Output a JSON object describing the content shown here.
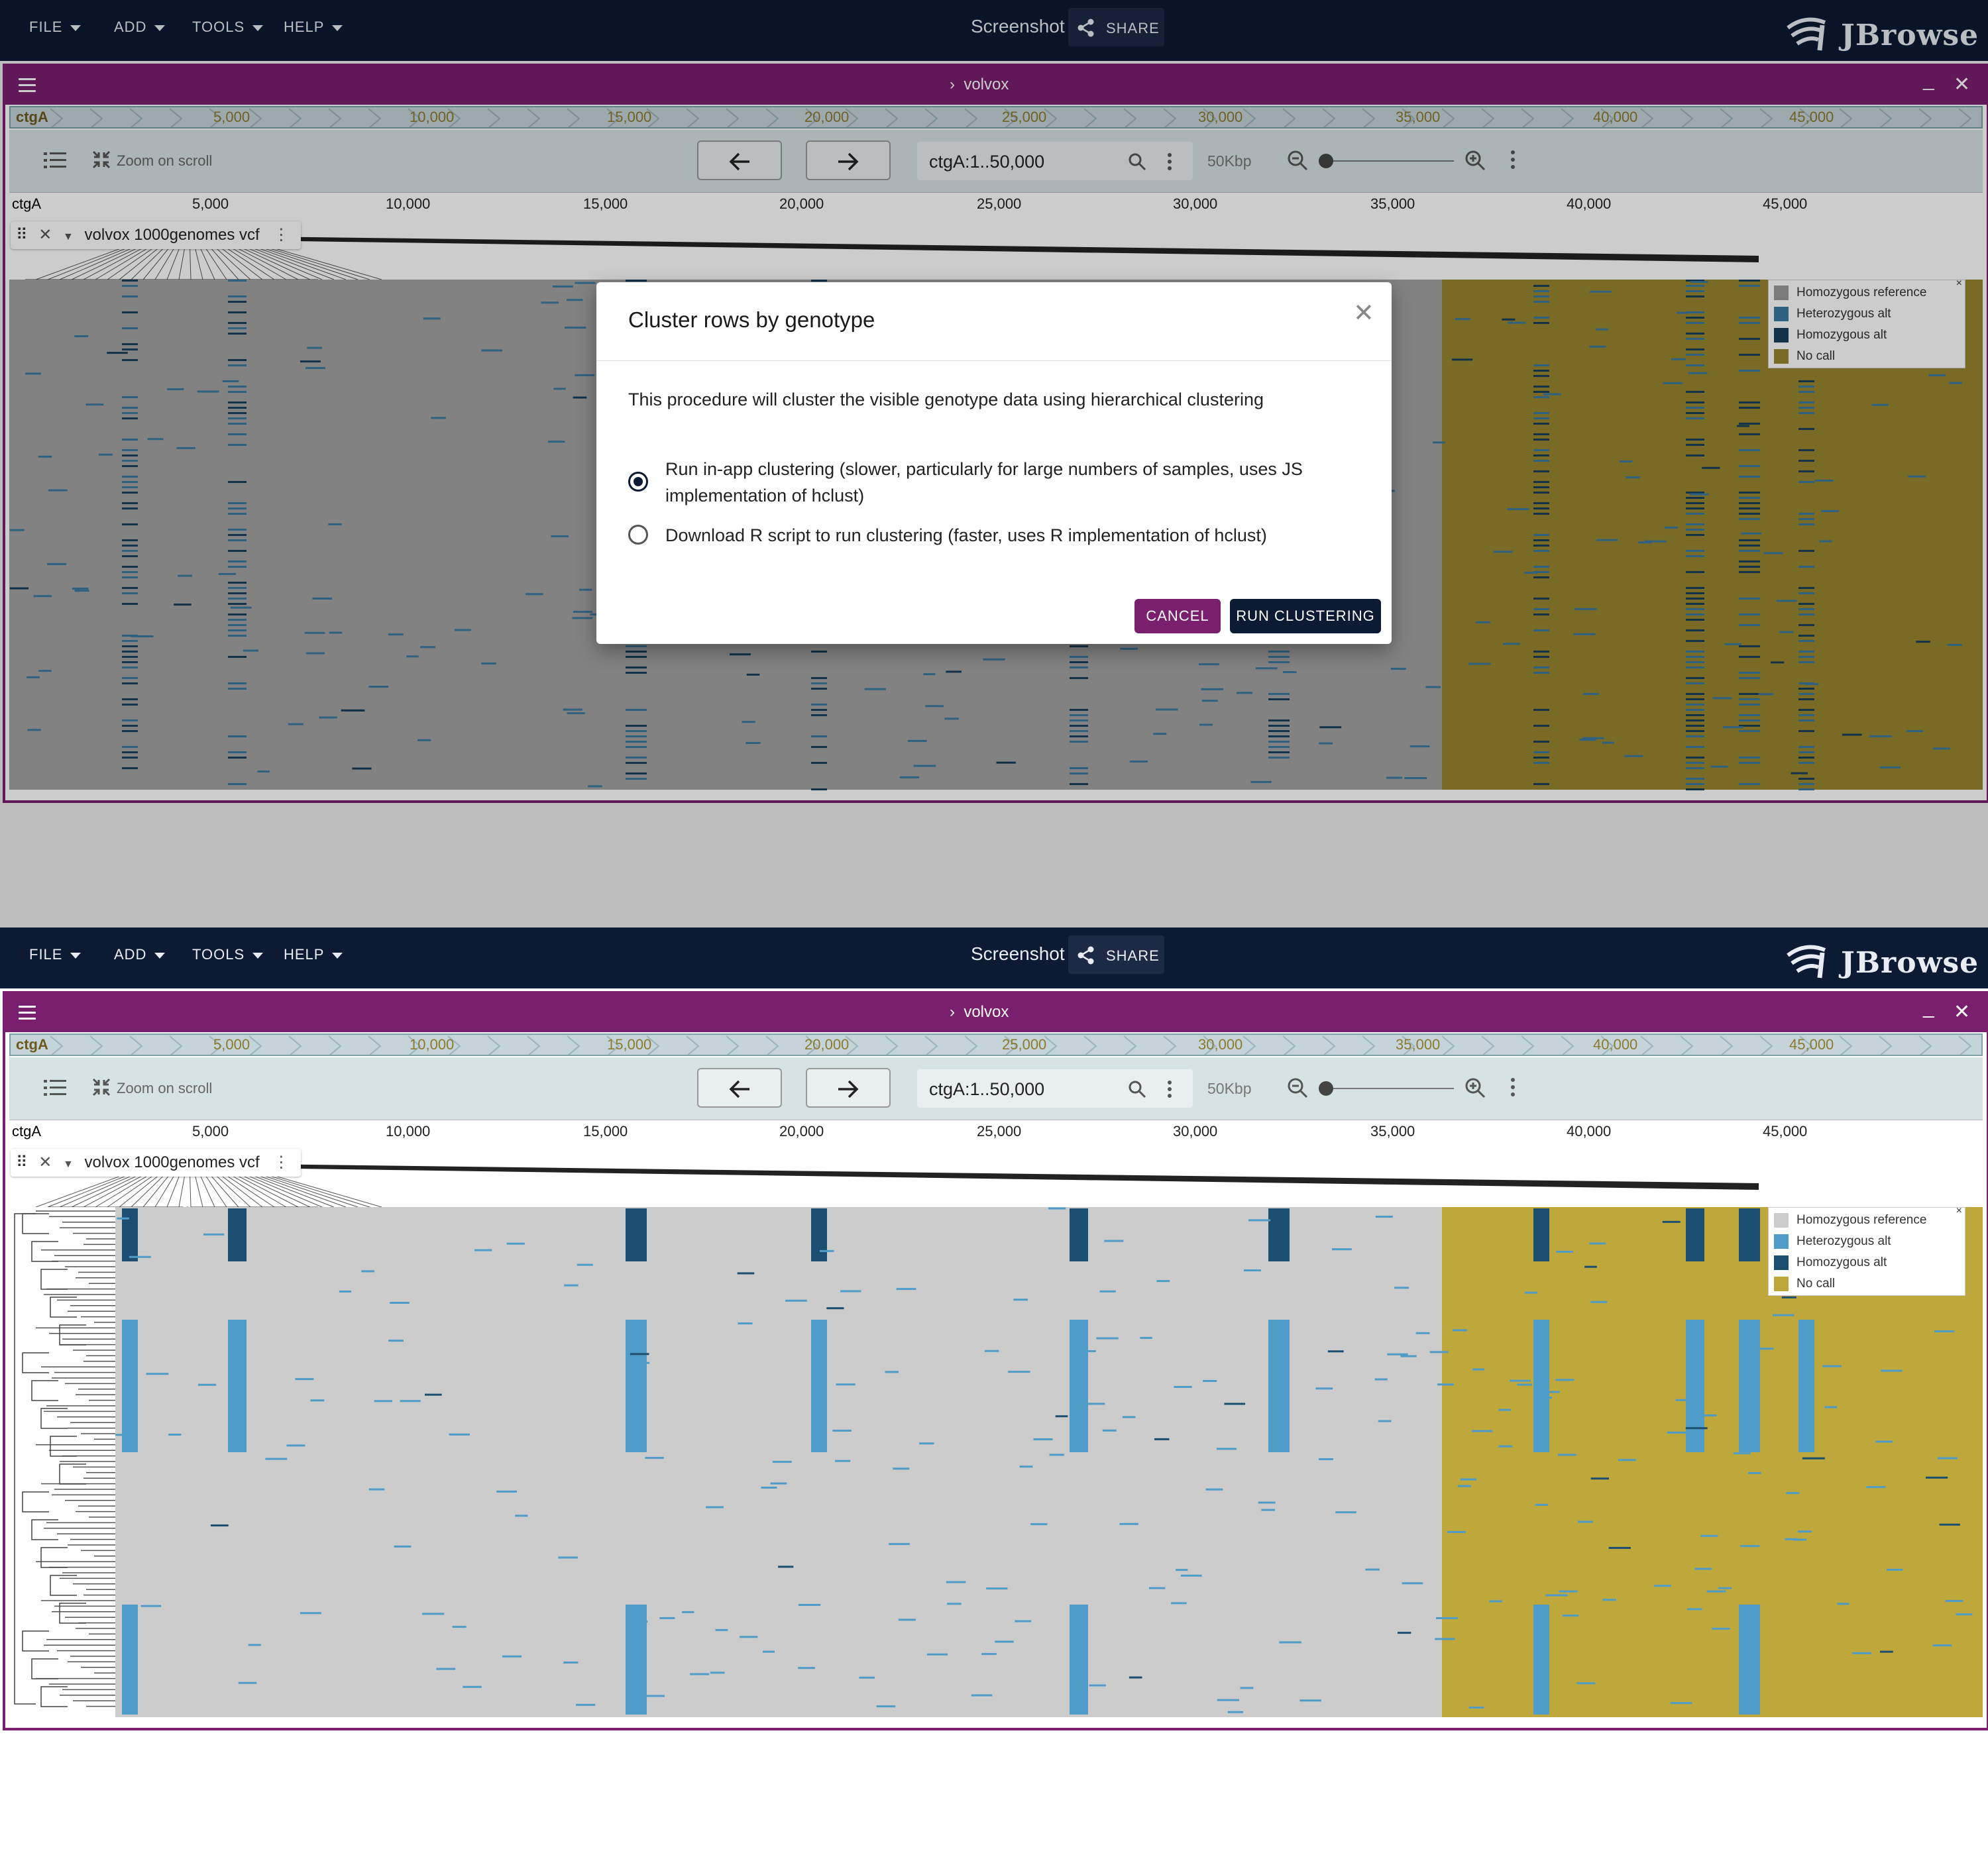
{
  "app": {
    "menus": [
      "FILE",
      "ADD",
      "TOOLS",
      "HELP"
    ],
    "title": "Screenshot",
    "share_label": "SHARE",
    "logo_text": "JBrowse"
  },
  "view": {
    "name": "volvox",
    "overview_ref": "ctgA",
    "overview_ticks": [
      "5,000",
      "10,000",
      "15,000",
      "20,000",
      "25,000",
      "30,000",
      "35,000",
      "40,000",
      "45,000"
    ],
    "zoom_on_scroll": "Zoom on scroll",
    "location": "ctgA:1..50,000",
    "bp_width": "50Kbp",
    "ruler_ref": "ctgA",
    "ruler_ticks": [
      "5,000",
      "10,000",
      "15,000",
      "20,000",
      "25,000",
      "30,000",
      "35,000",
      "40,000",
      "45,000"
    ],
    "track_name": "volvox 1000genomes vcf",
    "legend": [
      {
        "label": "Homozygous reference",
        "color": "#cccccc"
      },
      {
        "label": "Heterozygous alt",
        "color": "#4f9cc9"
      },
      {
        "label": "Homozygous alt",
        "color": "#1c4e72"
      },
      {
        "label": "No call",
        "color": "#bfa83b"
      }
    ]
  },
  "dialog": {
    "title": "Cluster rows by genotype",
    "description": "This procedure will cluster the visible genotype data using hierarchical clustering",
    "option_inapp": "Run in-app clustering (slower, particularly for large numbers of samples, uses JS implementation of hclust)",
    "option_r": "Download R script to run clustering (faster, uses R implementation of hclust)",
    "selected_option": "inapp",
    "cancel_label": "CANCEL",
    "run_label": "RUN CLUSTERING"
  }
}
